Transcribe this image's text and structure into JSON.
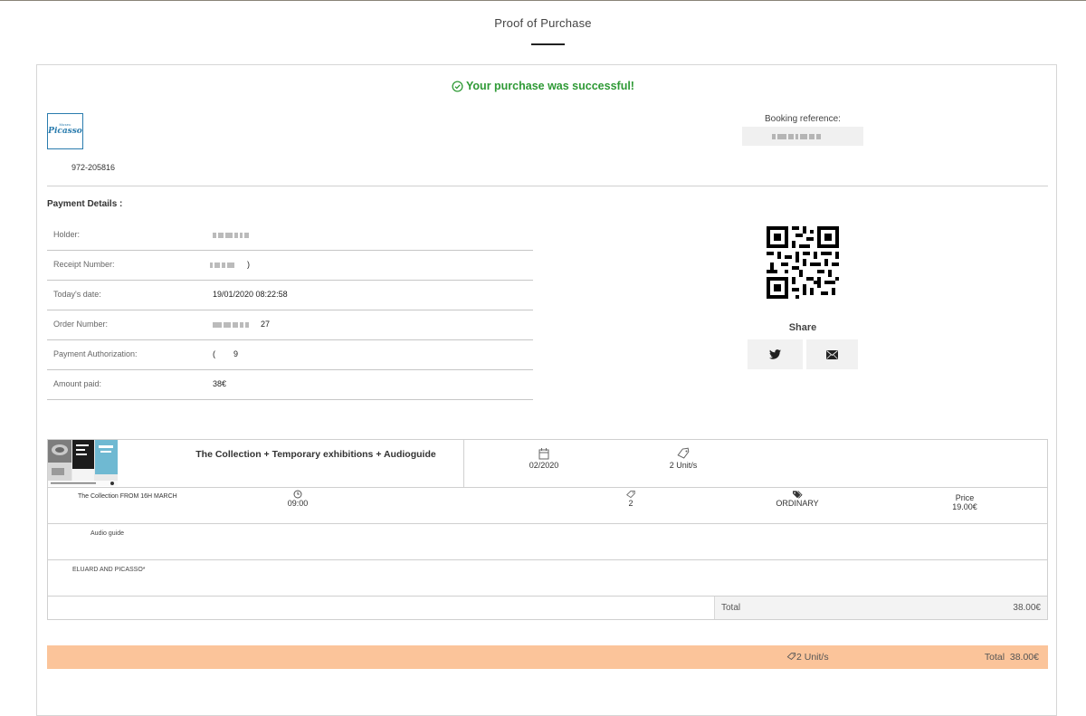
{
  "page": {
    "title": "Proof of Purchase"
  },
  "status": {
    "message": "Your purchase was successful!",
    "color": "#2f9a36"
  },
  "venue": {
    "logo_small_text": "Museu",
    "logo_text": "Picasso",
    "phone": "972-205816"
  },
  "booking": {
    "label": "Booking reference:"
  },
  "payment": {
    "title": "Payment Details :",
    "rows": [
      {
        "label": "Holder:",
        "value": ""
      },
      {
        "label": "Receipt Number:",
        "value": ")"
      },
      {
        "label": "Today's date:",
        "value": "19/01/2020 08:22:58"
      },
      {
        "label": "Order Number:",
        "value": "27"
      },
      {
        "label": "Payment Authorization:",
        "value": "(        9"
      },
      {
        "label": "Amount paid:",
        "value": "38€"
      }
    ]
  },
  "share": {
    "label": "Share",
    "buttons": [
      {
        "icon": "twitter-icon"
      },
      {
        "icon": "mail-icon"
      }
    ]
  },
  "product": {
    "title": "The Collection + Temporary exhibitions + Audioguide",
    "date": "02/2020",
    "units": "2 Unit/s",
    "line": {
      "name": "The Collection FROM 16H MARCH",
      "time": "09:00",
      "quantity": "2",
      "rate": "ORDINARY",
      "price_label": "Price",
      "price": "19.00€"
    },
    "extras": [
      "Audio guide",
      "ELUARD AND PICASSO*"
    ],
    "total_label": "Total",
    "total_value": "38.00€"
  },
  "summary": {
    "units": "2 Unit/s",
    "total": "Total  38.00€",
    "color": "#fbc49a"
  }
}
